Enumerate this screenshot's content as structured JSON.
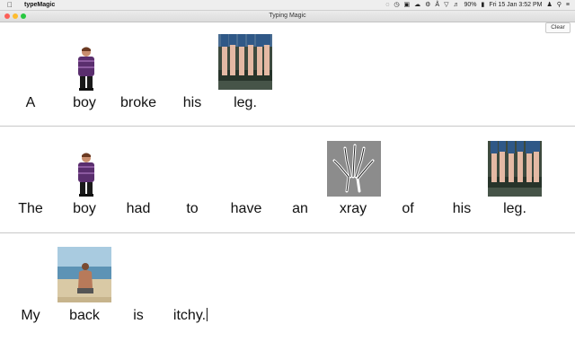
{
  "menubar": {
    "app_name": "typeMagic",
    "battery": "90%",
    "datetime": "Fri 15 Jan  3:52 PM"
  },
  "window": {
    "title": "Typing Magic"
  },
  "toolbar": {
    "clear_label": "Clear"
  },
  "sentences": [
    {
      "words": [
        "A",
        "boy",
        "broke",
        "his",
        "leg."
      ],
      "images": [
        "boy-icon",
        "feet-in-water-icon"
      ]
    },
    {
      "words": [
        "The",
        "boy",
        "had",
        "to",
        "have",
        "an",
        "xray",
        "of",
        "his",
        "leg."
      ],
      "images": [
        "boy-icon",
        "xray-hand-icon",
        "feet-in-water-icon"
      ]
    },
    {
      "words": [
        "My",
        "back",
        "is",
        "itchy."
      ],
      "images": [
        "man-back-at-beach-icon"
      ]
    }
  ]
}
